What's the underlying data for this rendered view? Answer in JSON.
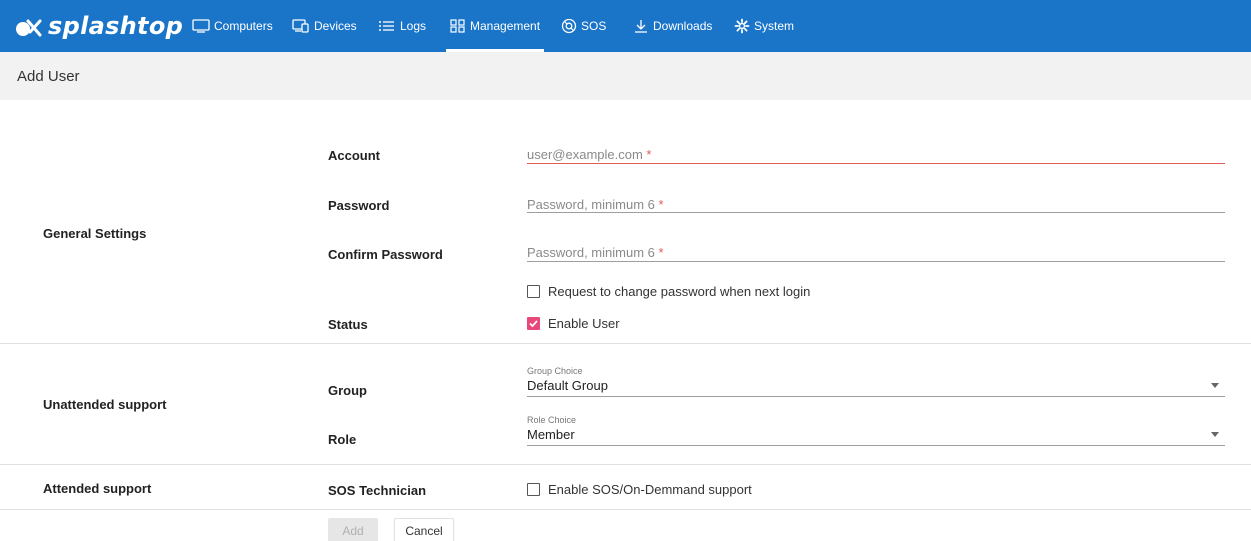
{
  "brand": {
    "name": "splashtop",
    "color": "#1a75c9"
  },
  "nav": {
    "items": [
      {
        "label": "Computers",
        "icon": "monitor-icon"
      },
      {
        "label": "Devices",
        "icon": "devices-icon"
      },
      {
        "label": "Logs",
        "icon": "list-icon"
      },
      {
        "label": "Management",
        "icon": "grid-icon",
        "active": true
      },
      {
        "label": "SOS",
        "icon": "lifebuoy-icon"
      },
      {
        "label": "Downloads",
        "icon": "download-icon"
      },
      {
        "label": "System",
        "icon": "gear-icon"
      }
    ]
  },
  "page": {
    "title": "Add User"
  },
  "sections": {
    "general": "General Settings",
    "unattended": "Unattended support",
    "attended": "Attended support"
  },
  "fields": {
    "account": {
      "label": "Account",
      "placeholder": "user@example.com",
      "required_mark": "*"
    },
    "password": {
      "label": "Password",
      "placeholder": "Password, minimum 6",
      "required_mark": "*"
    },
    "confirm": {
      "label": "Confirm Password",
      "placeholder": "Password, minimum 6",
      "required_mark": "*"
    },
    "change_pw": {
      "label": "Request to change password when next login",
      "checked": false
    },
    "status": {
      "label": "Status",
      "option": "Enable User",
      "checked": true
    },
    "group": {
      "label": "Group",
      "caption": "Group Choice",
      "value": "Default Group"
    },
    "role": {
      "label": "Role",
      "caption": "Role Choice",
      "value": "Member"
    },
    "sos": {
      "label": "SOS Technician",
      "option": "Enable SOS/On-Demmand support",
      "checked": false
    }
  },
  "buttons": {
    "add": "Add",
    "cancel": "Cancel"
  },
  "colors": {
    "accent_check": "#e8497a",
    "error_underline": "#e15a5a"
  }
}
